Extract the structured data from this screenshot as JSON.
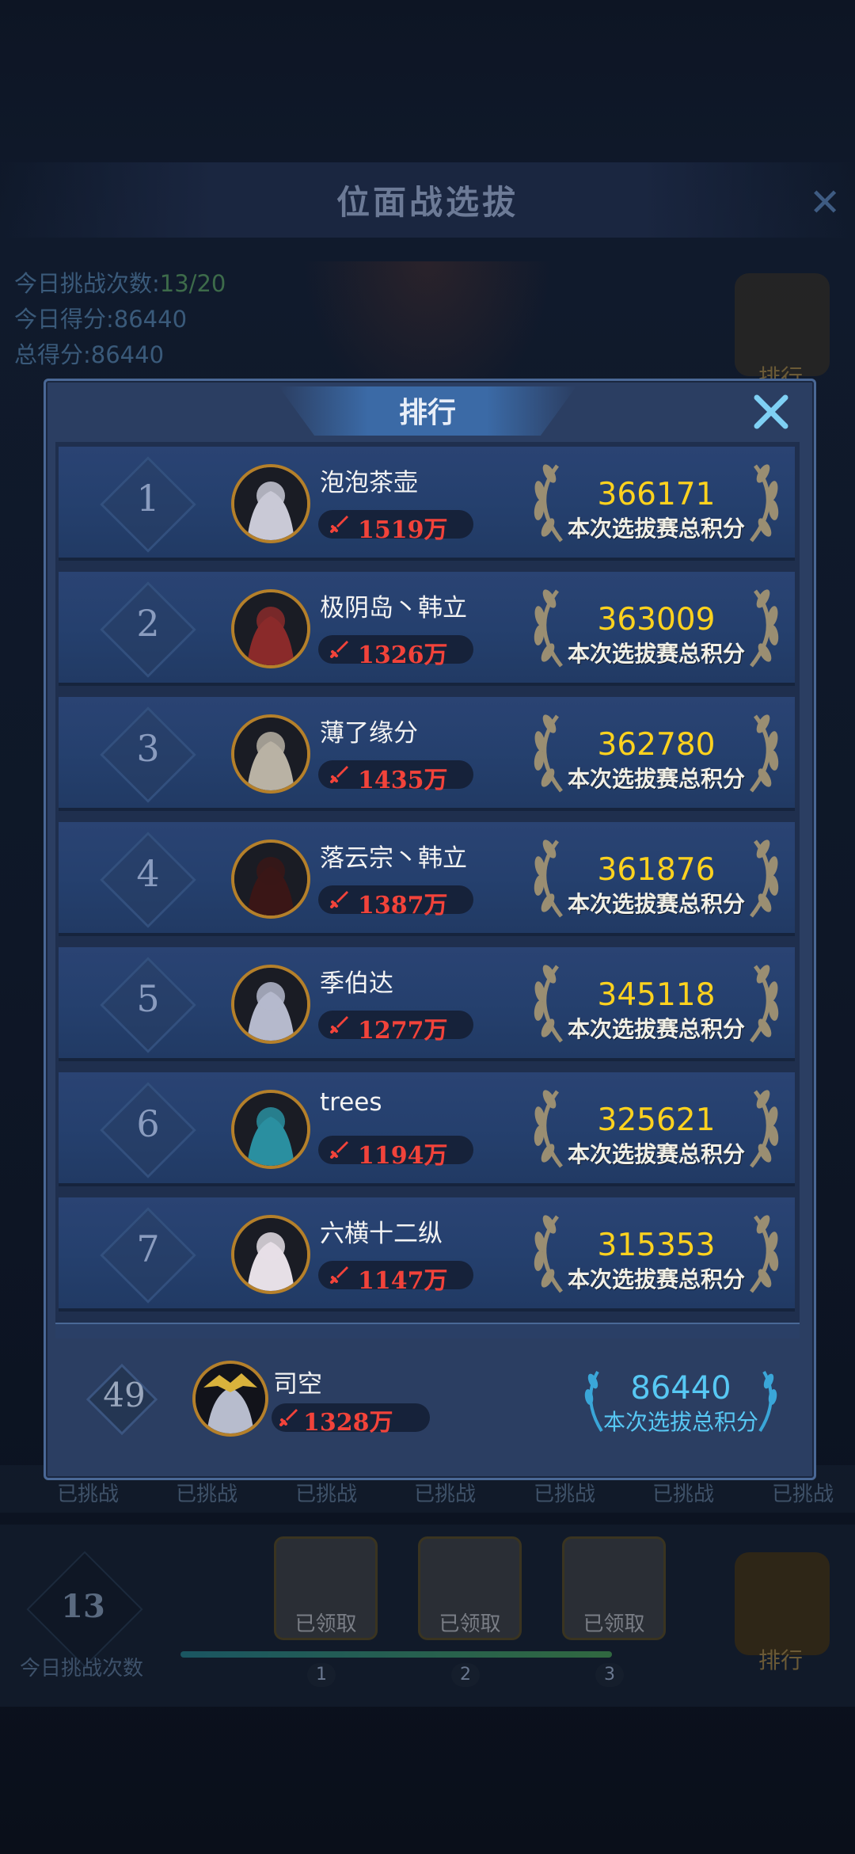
{
  "background": {
    "title": "位面战选拔",
    "stats": [
      {
        "label": "今日挑战次数:",
        "value": "13/20"
      },
      {
        "label": "今日得分:",
        "value": "86440"
      },
      {
        "label": "总得分:",
        "value": "86440"
      }
    ],
    "rank_corner_label": "排行",
    "challenged_label": "已挑战",
    "challenge_count": "13",
    "challenge_count_label": "今日挑战次数",
    "chests": [
      {
        "label": "已领取",
        "step": "1"
      },
      {
        "label": "已领取",
        "step": "2"
      },
      {
        "label": "已领取",
        "step": "3"
      }
    ],
    "rank_button_label": "排行"
  },
  "dialog": {
    "title": "排行",
    "score_label": "本次选拔赛总积分",
    "rows": [
      {
        "rank": "1",
        "name": "泡泡茶壶",
        "power": "1519万",
        "score": "366171",
        "avatar_color": "#c9c9d6"
      },
      {
        "rank": "2",
        "name": "极阴岛丶韩立",
        "power": "1326万",
        "score": "363009",
        "avatar_color": "#8a2a2a"
      },
      {
        "rank": "3",
        "name": "薄了缘分",
        "power": "1435万",
        "score": "362780",
        "avatar_color": "#b9b2a4"
      },
      {
        "rank": "4",
        "name": "落云宗丶韩立",
        "power": "1387万",
        "score": "361876",
        "avatar_color": "#3a1616"
      },
      {
        "rank": "5",
        "name": "季伯达",
        "power": "1277万",
        "score": "345118",
        "avatar_color": "#b5b9cc"
      },
      {
        "rank": "6",
        "name": "trees",
        "power": "1194万",
        "score": "325621",
        "avatar_color": "#2a8fa0"
      },
      {
        "rank": "7",
        "name": "六横十二纵",
        "power": "1147万",
        "score": "315353",
        "avatar_color": "#e6dfe6"
      }
    ],
    "self": {
      "rank": "49",
      "name": "司空",
      "power": "1328万",
      "score": "86440",
      "score_label": "本次选拔总积分"
    }
  },
  "colors": {
    "score_gold": "#ffd21e",
    "power_red": "#f2433a",
    "self_score_blue": "#57c8f4"
  }
}
